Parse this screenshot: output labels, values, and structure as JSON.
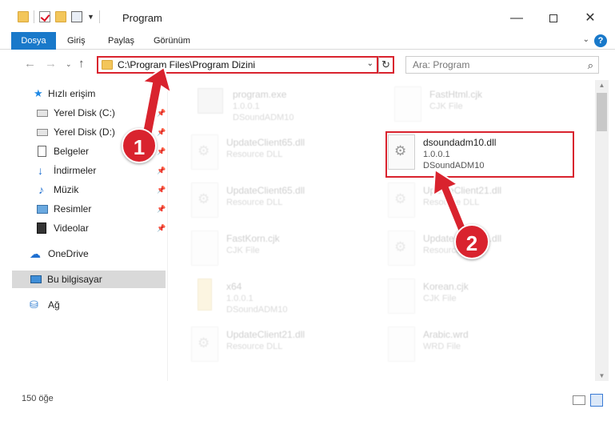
{
  "window": {
    "title": "Program",
    "minimize": "—",
    "close": "✕"
  },
  "ribbon": {
    "tabs": [
      "Dosya",
      "Giriş",
      "Paylaş",
      "Görünüm"
    ],
    "help": "?",
    "collapse": "⌄"
  },
  "nav": {
    "back": "←",
    "forward": "→",
    "recent": "⌄",
    "up": "↑",
    "address_path": "C:\\Program Files\\Program Dizini",
    "address_dropdown": "⌄",
    "refresh": "↻",
    "search_placeholder": "Ara: Program",
    "search_icon": "⌕"
  },
  "sidebar": {
    "items": [
      {
        "label": "Hızlı erişim",
        "icon": "star-icon",
        "glyph": "★"
      },
      {
        "label": "Yerel Disk (C:)",
        "icon": "disk-icon",
        "glyph": ""
      },
      {
        "label": "Yerel Disk (D:)",
        "icon": "disk-icon",
        "glyph": ""
      },
      {
        "label": "Belgeler",
        "icon": "document-icon",
        "glyph": ""
      },
      {
        "label": "İndirmeler",
        "icon": "download-icon",
        "glyph": "↓"
      },
      {
        "label": "Müzik",
        "icon": "music-icon",
        "glyph": "♪"
      },
      {
        "label": "Resimler",
        "icon": "picture-icon",
        "glyph": ""
      },
      {
        "label": "Videolar",
        "icon": "video-icon",
        "glyph": ""
      },
      {
        "label": "OneDrive",
        "icon": "cloud-icon",
        "glyph": "☁"
      },
      {
        "label": "Bu bilgisayar",
        "icon": "computer-icon",
        "glyph": ""
      },
      {
        "label": "Ağ",
        "icon": "network-icon",
        "glyph": "⛁"
      }
    ],
    "pin_glyph": "📌"
  },
  "files": [
    {
      "name": "program.exe",
      "meta1": "1.0.0.1",
      "meta2": "DSoundADM10",
      "icon": "exe"
    },
    {
      "name": "FastHtml.cjk",
      "meta1": "CJK File",
      "meta2": "",
      "icon": "doc"
    },
    {
      "name": "UpdateClient65.dll",
      "meta1": "Resource DLL",
      "meta2": "",
      "icon": "gear"
    },
    {
      "name": "dsoundadm10.dll",
      "meta1": "1.0.0.1",
      "meta2": "DSoundADM10",
      "icon": "gear"
    },
    {
      "name": "UpdateClient65.dll",
      "meta1": "Resource DLL",
      "meta2": "",
      "icon": "gear"
    },
    {
      "name": "UpdateClient21.dll",
      "meta1": "Resource DLL",
      "meta2": "",
      "icon": "gear"
    },
    {
      "name": "FastKorn.cjk",
      "meta1": "CJK File",
      "meta2": "",
      "icon": "doc"
    },
    {
      "name": "UpdateClient42.dll",
      "meta1": "Resource DLL",
      "meta2": "",
      "icon": "gear"
    },
    {
      "name": "x64",
      "meta1": "1.0.0.1",
      "meta2": "DSoundADM10",
      "icon": "folder"
    },
    {
      "name": "Korean.cjk",
      "meta1": "CJK File",
      "meta2": "",
      "icon": "doc"
    },
    {
      "name": "UpdateClient21.dll",
      "meta1": "Resource DLL",
      "meta2": "",
      "icon": "gear"
    },
    {
      "name": "Arabic.wrd",
      "meta1": "WRD File",
      "meta2": "",
      "icon": "doc"
    }
  ],
  "status": {
    "count": "150 öğe"
  },
  "annotations": {
    "step1": "1",
    "step2": "2",
    "color": "#d9232e"
  }
}
